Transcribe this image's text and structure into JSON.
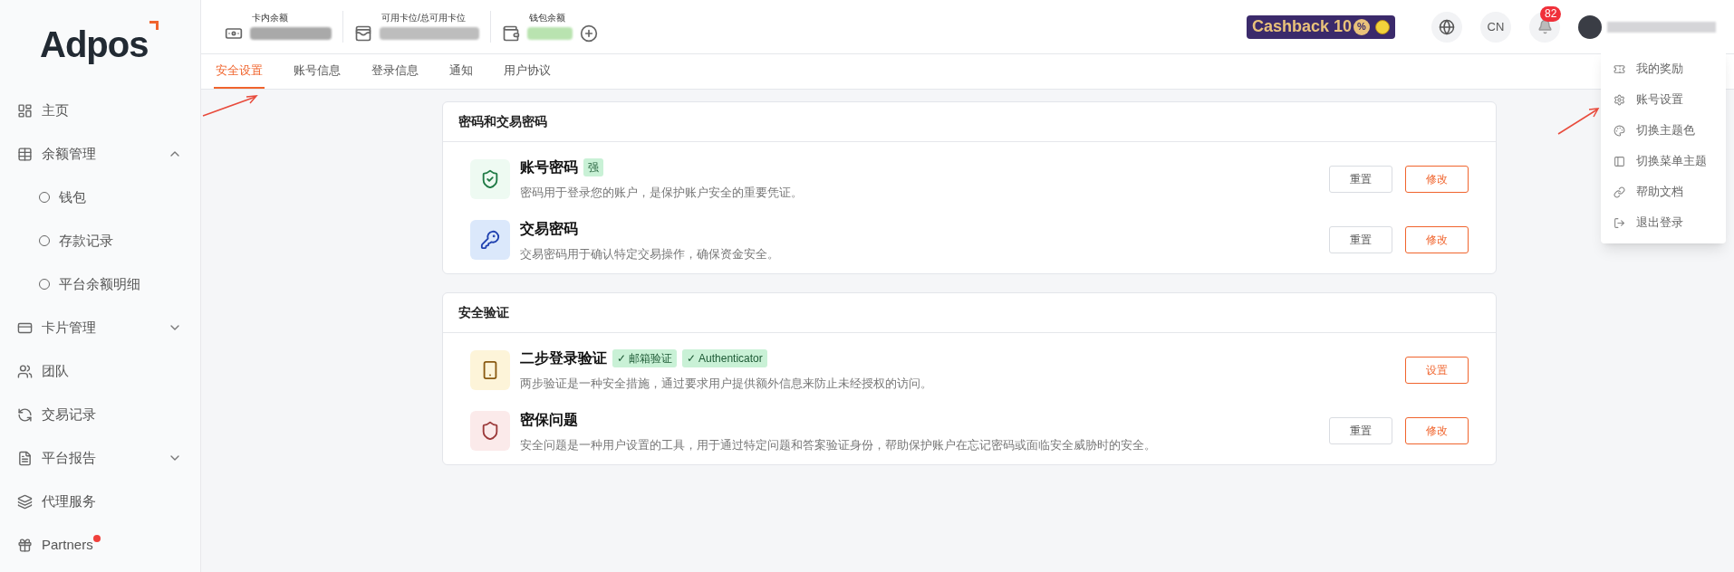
{
  "logo": {
    "text": "Adpos"
  },
  "sidebar": {
    "items": [
      {
        "label": "主页",
        "selected": false
      },
      {
        "label": "余额管理",
        "selected": false,
        "expanded": true,
        "children": [
          {
            "label": "钱包",
            "selected": false
          },
          {
            "label": "存款记录",
            "selected": false
          },
          {
            "label": "平台余额明细",
            "selected": false
          }
        ]
      },
      {
        "label": "卡片管理",
        "selected": false,
        "expanded": false
      },
      {
        "label": "团队",
        "selected": false
      },
      {
        "label": "交易记录",
        "selected": false
      },
      {
        "label": "平台报告",
        "selected": false,
        "expanded": false
      },
      {
        "label": "代理服务",
        "selected": false
      },
      {
        "label": "Partners",
        "selected": false,
        "dot": true
      }
    ]
  },
  "topbar": {
    "balances": [
      {
        "label": "卡内余额"
      },
      {
        "label": "可用卡位/总可用卡位"
      },
      {
        "label": "钱包余额"
      }
    ],
    "promo": {
      "text": "Cashback 10",
      "badge": "%"
    },
    "language": "CN",
    "notifications": "82"
  },
  "tabs": [
    {
      "label": "安全设置",
      "selected": true
    },
    {
      "label": "账号信息",
      "selected": false
    },
    {
      "label": "登录信息",
      "selected": false
    },
    {
      "label": "通知",
      "selected": false
    },
    {
      "label": "用户协议",
      "selected": false
    }
  ],
  "sections": [
    {
      "title": "密码和交易密码",
      "items": [
        {
          "title": "账号密码",
          "color": "#eefaf2",
          "tags": [
            "强"
          ],
          "description": "密码用于登录您的账户，是保护账户安全的重要凭证。",
          "buttons": [
            {
              "label": "重置",
              "kind": "default"
            },
            {
              "label": "修改",
              "kind": "primary"
            }
          ]
        },
        {
          "title": "交易密码",
          "color": "#dbe8fb",
          "description": "交易密码用于确认特定交易操作，确保资金安全。",
          "buttons": [
            {
              "label": "重置",
              "kind": "default"
            },
            {
              "label": "修改",
              "kind": "primary"
            }
          ]
        }
      ]
    },
    {
      "title": "安全验证",
      "items": [
        {
          "title": "二步登录验证",
          "color": "#fdf4d9",
          "tags": [
            "✓ 邮箱验证",
            "✓ Authenticator"
          ],
          "description": "两步验证是一种安全措施，通过要求用户提供额外信息来防止未经授权的访问。",
          "buttons": [
            {
              "label": "设置",
              "kind": "primary"
            }
          ]
        },
        {
          "title": "密保问题",
          "color": "#fbeaea",
          "description": "安全问题是一种用户设置的工具，用于通过特定问题和答案验证身份，帮助保护账户在忘记密码或面临安全威胁时的安全。",
          "buttons": [
            {
              "label": "重置",
              "kind": "default"
            },
            {
              "label": "修改",
              "kind": "primary"
            }
          ]
        }
      ]
    }
  ],
  "user_menu": [
    {
      "label": "我的奖励"
    },
    {
      "label": "账号设置"
    },
    {
      "label": "切换主题色"
    },
    {
      "label": "切换菜单主题"
    },
    {
      "label": "帮助文档"
    },
    {
      "label": "退出登录"
    }
  ]
}
